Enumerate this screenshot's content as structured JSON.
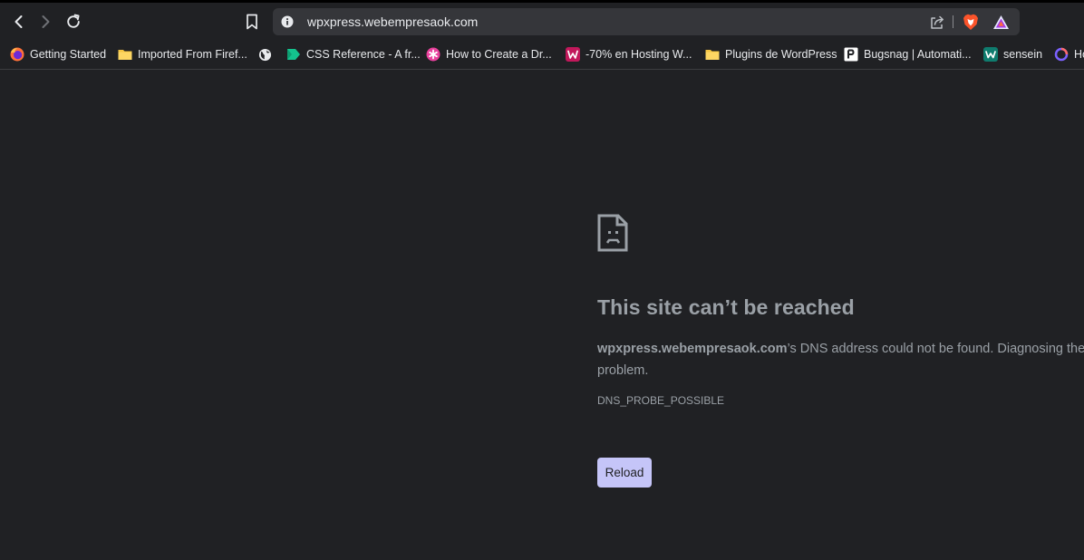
{
  "toolbar": {
    "url": "wpxpress.webempresaok.com"
  },
  "bookmarks": [
    {
      "label": "Getting Started",
      "icon": "firefox-icon"
    },
    {
      "label": "Imported From Firef...",
      "icon": "folder-icon"
    },
    {
      "label": "",
      "icon": "globe-icon"
    },
    {
      "label": "CSS Reference - A fr...",
      "icon": "css-reference-icon"
    },
    {
      "label": "How to Create a Dr...",
      "icon": "asterisk-icon"
    },
    {
      "label": "-70% en Hosting W...",
      "icon": "webempresa-icon"
    },
    {
      "label": "Plugins de WordPress",
      "icon": "folder-icon"
    },
    {
      "label": "Bugsnag | Automati...",
      "icon": "bugsnag-icon"
    },
    {
      "label": "sensein",
      "icon": "sensein-icon"
    },
    {
      "label": "Ho",
      "icon": "ring-icon"
    }
  ],
  "error": {
    "title": "This site can’t be reached",
    "host": "wpxpress.webempresaok.com",
    "message": "’s DNS address could not be found. Diagnosing the problem.",
    "code": "DNS_PROBE_POSSIBLE",
    "reload_label": "Reload"
  },
  "colors": {
    "background": "#202124",
    "omnibox": "#35363a",
    "text_muted": "#9aa0a6",
    "reload_button": "#c5c5f8"
  }
}
